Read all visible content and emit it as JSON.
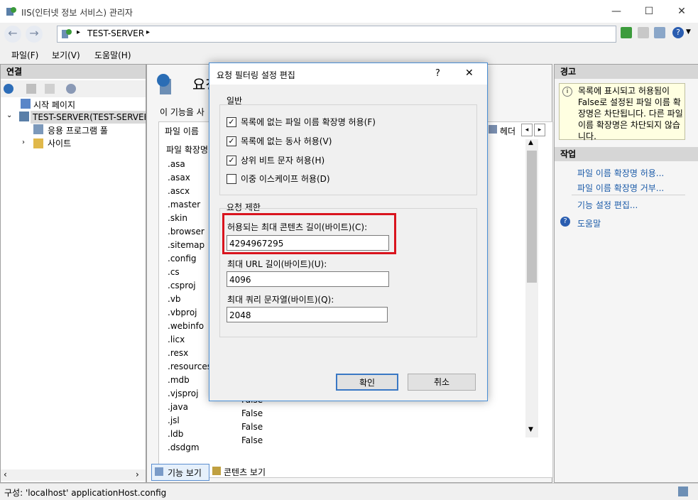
{
  "window": {
    "title": "IIS(인터넷 정보 서비스) 관리자",
    "minimize": "—",
    "maximize": "☐",
    "close": "✕"
  },
  "address": {
    "path": "TEST-SERVER",
    "sep1": "▸",
    "sep2": "▸"
  },
  "menu": {
    "file": "파일(F)",
    "view": "보기(V)",
    "help": "도움말(H)"
  },
  "left": {
    "header": "연결",
    "tree": [
      {
        "label": "시작 페이지"
      },
      {
        "label": "TEST-SERVER(TEST-SERVER\\"
      },
      {
        "label": "응용 프로그램 풀"
      },
      {
        "label": "사이트"
      }
    ]
  },
  "center": {
    "title": "요청",
    "desc": "이 기능을 사",
    "tab_file": "파일 이름",
    "tab_header": "헤더",
    "col_ext": "파일 확장명",
    "extensions": [
      ".asa",
      ".asax",
      ".ascx",
      ".master",
      ".skin",
      ".browser",
      ".sitemap",
      ".config",
      ".cs",
      ".csproj",
      ".vb",
      ".vbproj",
      ".webinfo",
      ".licx",
      ".resx",
      ".resources",
      ".mdb",
      ".vjsproj",
      ".java",
      ".jsl",
      ".ldb",
      ".dsdgm"
    ],
    "allowed_values": [
      "False",
      "False",
      "False",
      "False"
    ],
    "view_feature": "기능 보기",
    "view_content": "콘텐츠 보기"
  },
  "right": {
    "alert_header": "경고",
    "alert_text": "목록에 표시되고 허용됨이 False로 설정된 파일 이름 확장명은 차단됩니다. 다른 파일 이름 확장명은 차단되지 않습니다.",
    "actions_header": "작업",
    "actions": [
      "파일 이름 확장명 허용...",
      "파일 이름 확장명 거부...",
      "기능 설정 편집...",
      "도움말"
    ]
  },
  "status": {
    "text": "구성: 'localhost' applicationHost.config"
  },
  "dialog": {
    "title": "요청 필터링 설정 편집",
    "help": "?",
    "close": "✕",
    "general_label": "일반",
    "checks": [
      {
        "label": "목록에 없는 파일 이름 확장명 허용(F)",
        "checked": true
      },
      {
        "label": "목록에 없는 동사 허용(V)",
        "checked": true
      },
      {
        "label": "상위 비트 문자 허용(H)",
        "checked": true
      },
      {
        "label": "이중 이스케이프 허용(D)",
        "checked": false
      }
    ],
    "limits_label": "요청 제한",
    "max_content_label": "허용되는 최대 콘텐츠 길이(바이트)(C):",
    "max_content_value": "4294967295",
    "max_url_label": "최대 URL 길이(바이트)(U):",
    "max_url_value": "4096",
    "max_query_label": "최대 쿼리 문자열(바이트)(Q):",
    "max_query_value": "2048",
    "ok": "확인",
    "cancel": "취소",
    "highlight_color": "#d9141e"
  }
}
